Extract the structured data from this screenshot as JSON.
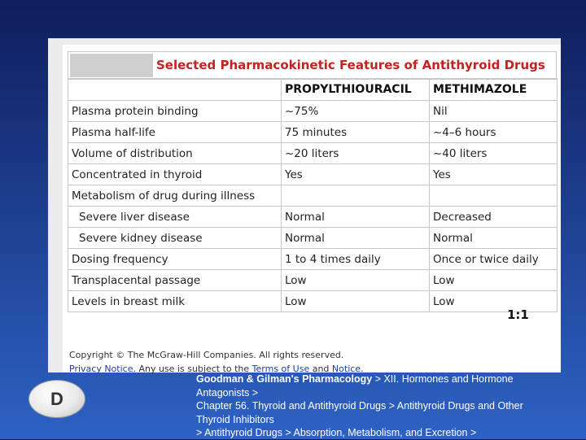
{
  "table": {
    "title": "Selected Pharmacokinetic Features of Antithyroid Drugs",
    "columns": [
      "",
      "PROPYLTHIOURACIL",
      "METHIMAZOLE"
    ],
    "rows": [
      [
        "Plasma protein binding",
        "~75%",
        "Nil"
      ],
      [
        "Plasma half-life",
        "75 minutes",
        "~4–6 hours"
      ],
      [
        "Volume of distribution",
        "~20 liters",
        "~40 liters"
      ],
      [
        "Concentrated in thyroid",
        "Yes",
        "Yes"
      ],
      [
        "Metabolism of drug during illness",
        "",
        ""
      ],
      [
        "Severe liver disease",
        "Normal",
        "Decreased"
      ],
      [
        "Severe kidney disease",
        "Normal",
        "Normal"
      ],
      [
        "Dosing frequency",
        "1 to 4 times daily",
        "Once or twice daily"
      ],
      [
        "Transplacental passage",
        "Low",
        "Low"
      ],
      [
        "Levels in breast milk",
        "Low",
        "Low"
      ]
    ],
    "ratio_annotation": "1:1"
  },
  "footer": {
    "copyright": "Copyright © The McGraw-Hill Companies.  All rights reserved.",
    "privacy_link": "Privacy Notice",
    "privacy_mid": ". Any use is subject to the ",
    "terms_link": "Terms of Use",
    "and_text": " and ",
    "notice_link": "Notice",
    "end": "."
  },
  "badge": {
    "letter": "D"
  },
  "citation": {
    "book": "Goodman & Gilman's Pharmacology",
    "line1_rest": " > XII. Hormones and Hormone",
    "line2": "Antagonists >",
    "line3": "Chapter 56. Thyroid and Antithyroid Drugs > Antithyroid Drugs and Other",
    "line4": "Thyroid Inhibitors",
    "line5": " > Antithyroid Drugs > Absorption, Metabolism, and Excretion >"
  },
  "colors": {
    "title_red": "#c62020",
    "link_blue": "#1a3ea8"
  }
}
